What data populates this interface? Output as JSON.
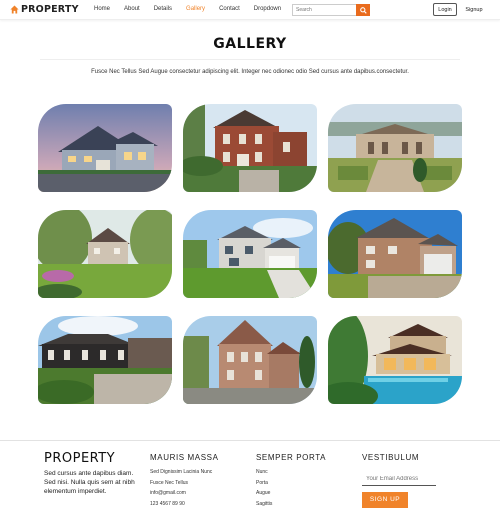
{
  "brand": {
    "name": "PROPERTY"
  },
  "nav": {
    "items": [
      "Home",
      "About",
      "Details",
      "Gallery",
      "Contact",
      "Dropdown"
    ],
    "active": "Gallery",
    "search_placeholder": "Search",
    "login_label": "Login",
    "signup_label": "Signup"
  },
  "page": {
    "title": "GALLERY",
    "intro": "Fusce Nec Tellus Sed Augue consectetur adipiscing elit. Integer nec odionec odio Sed cursus ante dapibus.consectetur."
  },
  "footer": {
    "brand": "PROPERTY",
    "brand_text": "Sed cursus ante dapibus diam. Sed nisi. Nulla quis sem at nibh elementum imperdiet.",
    "col1": {
      "title": "MAURIS MASSA",
      "lines": [
        "Sed Dignissim Lacinia Nunc",
        "Fusce Nec Tellus",
        "info@gmail.com",
        "123 4567 89 90"
      ]
    },
    "col2": {
      "title": "SEMPER PORTA",
      "lines": [
        "Nunc",
        "Porta",
        "Augue",
        "Sagittis"
      ]
    },
    "col3": {
      "title": "VESTIBULUM",
      "email_placeholder": "Your Email Address",
      "button_label": "SIGN UP"
    }
  },
  "colors": {
    "accent": "#f0832a",
    "search_button": "#e96b1d",
    "text": "#222222"
  },
  "icons": {
    "logo": "house-icon",
    "search": "search-icon"
  }
}
